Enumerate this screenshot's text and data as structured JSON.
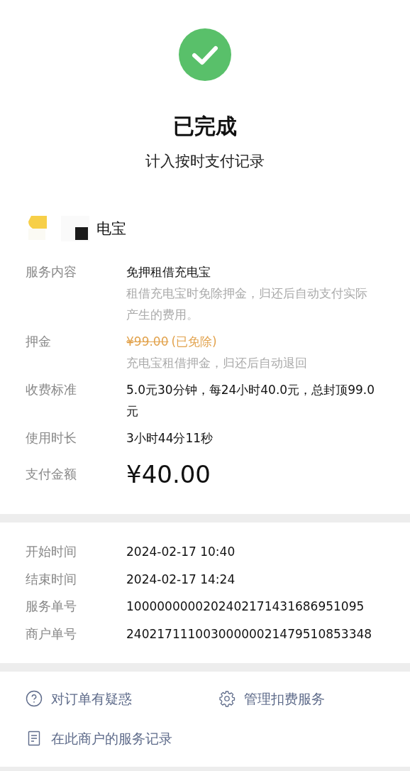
{
  "status": {
    "title": "已完成",
    "subtitle": "计入按时支付记录"
  },
  "merchant": {
    "name": "电宝"
  },
  "details": [
    {
      "kind": "text",
      "label": "服务内容",
      "value": "免押租借充电宝",
      "note": "租借充电宝时免除押金，归还后自动支付实际产生的费用。"
    },
    {
      "kind": "deposit",
      "label": "押金",
      "struck": "¥99.00",
      "value": "(已免除)",
      "note": "充电宝租借押金，归还后自动退回"
    },
    {
      "kind": "text",
      "label": "收费标准",
      "value": "5.0元30分钟，每24小时40.0元，总封顶99.0元"
    },
    {
      "kind": "text",
      "label": "使用时长",
      "value": "3小时44分11秒"
    },
    {
      "kind": "amount",
      "label": "支付金额",
      "value": "¥40.00"
    }
  ],
  "times": [
    {
      "label": "开始时间",
      "value": "2024-02-17 10:40"
    },
    {
      "label": "结束时间",
      "value": "2024-02-17 14:24"
    },
    {
      "label": "服务单号",
      "value": "1000000000202402171431686951095"
    },
    {
      "label": "商户单号",
      "value": "24021711100300000021479510853348"
    }
  ],
  "links": [
    {
      "label": "对订单有疑惑"
    },
    {
      "label": "管理扣费服务"
    },
    {
      "label": "在此商户的服务记录"
    }
  ]
}
